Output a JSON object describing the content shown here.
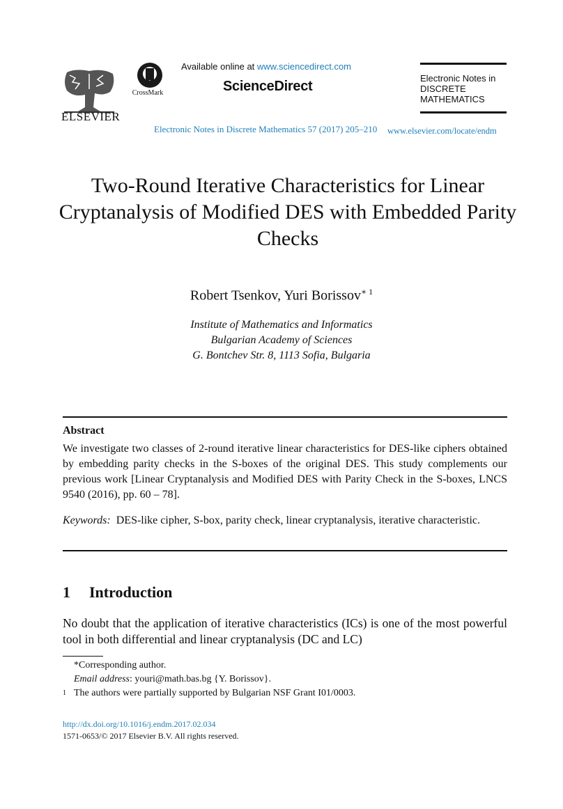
{
  "header": {
    "publisher_wordmark": "ELSEVIER",
    "crossmark_label": "CrossMark",
    "available_prefix": "Available online at ",
    "available_link": "www.sciencedirect.com",
    "sciencedirect_logo": "ScienceDirect",
    "journal_reference": "Electronic Notes in Discrete Mathematics 57 (2017) 205–210",
    "journal_badge": {
      "line1": "Electronic Notes in",
      "line2": "DISCRETE",
      "line3": "MATHEMATICS"
    },
    "journal_url": "www.elsevier.com/locate/endm",
    "link_color": "#1f7fb8"
  },
  "paper": {
    "title": "Two-Round Iterative Characteristics for Linear Cryptanalysis of Modified DES with Embedded Parity Checks",
    "authors": "Robert Tsenkov, Yuri Borissov",
    "author_marks": "∗ 1",
    "affiliation": [
      "Institute of Mathematics and Informatics",
      "Bulgarian Academy of Sciences",
      "G. Bontchev Str. 8, 1113 Sofia, Bulgaria"
    ],
    "abstract_heading": "Abstract",
    "abstract": "We investigate two classes of 2-round iterative linear characteristics for DES-like ciphers obtained by embedding parity checks in the S-boxes of the original DES. This study complements our previous work [Linear Cryptanalysis and Modified DES with Parity Check in the S-boxes, LNCS 9540 (2016), pp. 60 – 78].",
    "keywords_label": "Keywords:",
    "keywords": "DES-like cipher, S-box, parity check, linear cryptanalysis, iterative characteristic.",
    "section": {
      "number": "1",
      "title": "Introduction",
      "body": "No doubt that the application of iterative characteristics (ICs) is one of the most powerful tool in both differential and linear cryptanalysis (DC and LC)"
    },
    "footnotes": {
      "corresponding": "*Corresponding author.",
      "email_label": "Email address",
      "email_value": ": youri@math.bas.bg {Y. Borissov}.",
      "fn1_mark": "1",
      "fn1_text": "The authors were partially supported by Bulgarian NSF Grant I01/0003."
    }
  },
  "footer": {
    "doi": "http://dx.doi.org/10.1016/j.endm.2017.02.034",
    "copyright": "1571-0653/© 2017 Elsevier B.V. All rights reserved."
  }
}
